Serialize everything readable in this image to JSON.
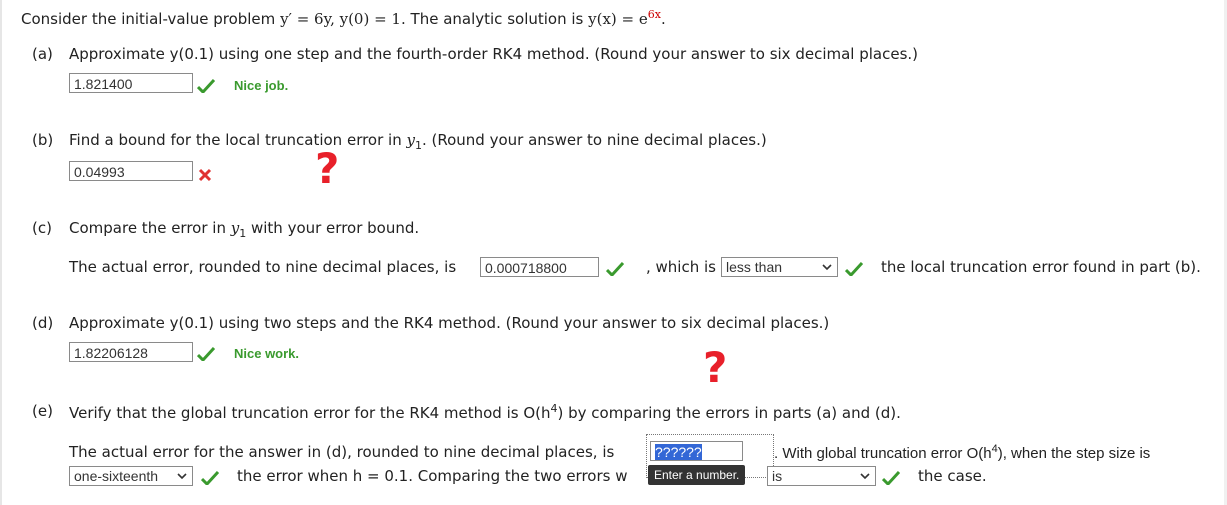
{
  "problem": {
    "intro": "Consider the initial-value problem",
    "ode": "y′ = 6y,  y(0) = 1.",
    "sol_intro": "The analytic solution is",
    "sol_lhs": "y(x) = e",
    "sol_exp": "6x",
    "period": "."
  },
  "part_a": {
    "label": "(a)",
    "question": "Approximate y(0.1) using one step and the fourth-order RK4 method. (Round your answer to six decimal places.)",
    "answer": "1.821400",
    "feedback": "Nice job."
  },
  "part_b": {
    "label": "(b)",
    "question_pre": "Find a bound for the local truncation error in ",
    "question_var": "y",
    "question_sub": "1",
    "question_post": ". (Round your answer to nine decimal places.)",
    "answer": "0.04993"
  },
  "part_c": {
    "label": "(c)",
    "question_pre": "Compare the error in ",
    "question_var": "y",
    "question_sub": "1",
    "question_post": " with your error bound.",
    "line_pre": "The actual error, rounded to nine decimal places, is",
    "answer": "0.000718800",
    "mid": ", which is",
    "select_value": "less than",
    "line_post": "the local truncation error found in part (b)."
  },
  "part_d": {
    "label": "(d)",
    "question": "Approximate y(0.1) using two steps and the RK4 method. (Round your answer to six decimal places.)",
    "answer": "1.82206128",
    "feedback": "Nice work."
  },
  "part_e": {
    "label": "(e)",
    "question_pre": "Verify that the global truncation error for the RK4 method is O(h",
    "question_sup": "4",
    "question_post": ") by comparing the errors in parts (a) and (d).",
    "line1_pre": "The actual error for the answer in (d), rounded to nine decimal places, is",
    "answer": "??????",
    "line1_post_pre": ". With global truncation error O(h",
    "line1_post_sup": "4",
    "line1_post_post": "), when the step size is",
    "select1_value": "one-sixteenth",
    "line2_a": "the error when h = 0.1. Comparing the two errors w",
    "tooltip": "Enter a number.",
    "select2_value": "is",
    "line2_b": "the case."
  },
  "colors": {
    "correct": "#3a9a2e",
    "wrong": "#e03131",
    "annotation": "#e8202a"
  }
}
